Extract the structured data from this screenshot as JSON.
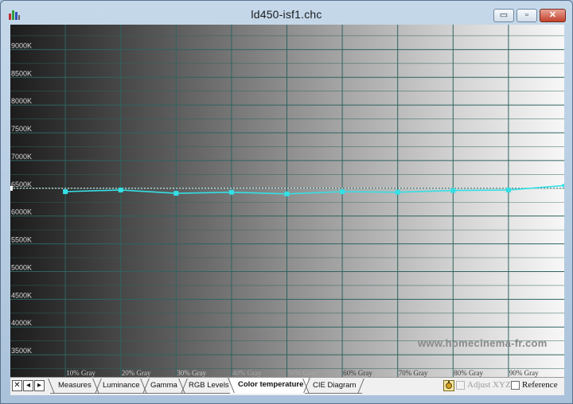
{
  "window": {
    "title": "ld450-isf1.chc",
    "controls": {
      "minimize": "▭",
      "maximize": "▫",
      "close": "✕"
    }
  },
  "watermark": "www.homecinema-fr.com",
  "chart_data": {
    "type": "line",
    "ylabel_ticks": [
      "9000K",
      "8500K",
      "8000K",
      "7500K",
      "7000K",
      "6500K",
      "6000K",
      "5500K",
      "5000K",
      "4500K",
      "4000K",
      "3500K"
    ],
    "ytick_values": [
      9000,
      8500,
      8000,
      7500,
      7000,
      6500,
      6000,
      5500,
      5000,
      4500,
      4000,
      3500
    ],
    "ylim": [
      3100,
      9450
    ],
    "reference_value": 6500,
    "x_labels": [
      "10% Gray",
      "20% Gray",
      "30% Gray",
      "40% Gray",
      "50% Gray",
      "60% Gray",
      "70% Gray",
      "80% Gray",
      "90% Gray"
    ],
    "xlim": [
      0,
      100
    ],
    "series": [
      {
        "color": "#33e0e6",
        "x": [
          10,
          20,
          30,
          40,
          50,
          60,
          70,
          80,
          90,
          100
        ],
        "values": [
          6440,
          6470,
          6410,
          6430,
          6400,
          6440,
          6430,
          6460,
          6470,
          6550
        ]
      }
    ],
    "grid": true,
    "grid_color": "#2e6460",
    "background": "grayscale ramp"
  },
  "tabs": {
    "nav": [
      "✕",
      "◂",
      "▸"
    ],
    "items": [
      {
        "label": "Measures"
      },
      {
        "label": "Luminance"
      },
      {
        "label": "Gamma"
      },
      {
        "label": "RGB Levels"
      },
      {
        "label": "Color temperature",
        "active": true
      },
      {
        "label": "CIE Diagram"
      }
    ]
  },
  "tools": {
    "adjust_xyz": "Adjust XYZ",
    "reference": "Reference"
  }
}
